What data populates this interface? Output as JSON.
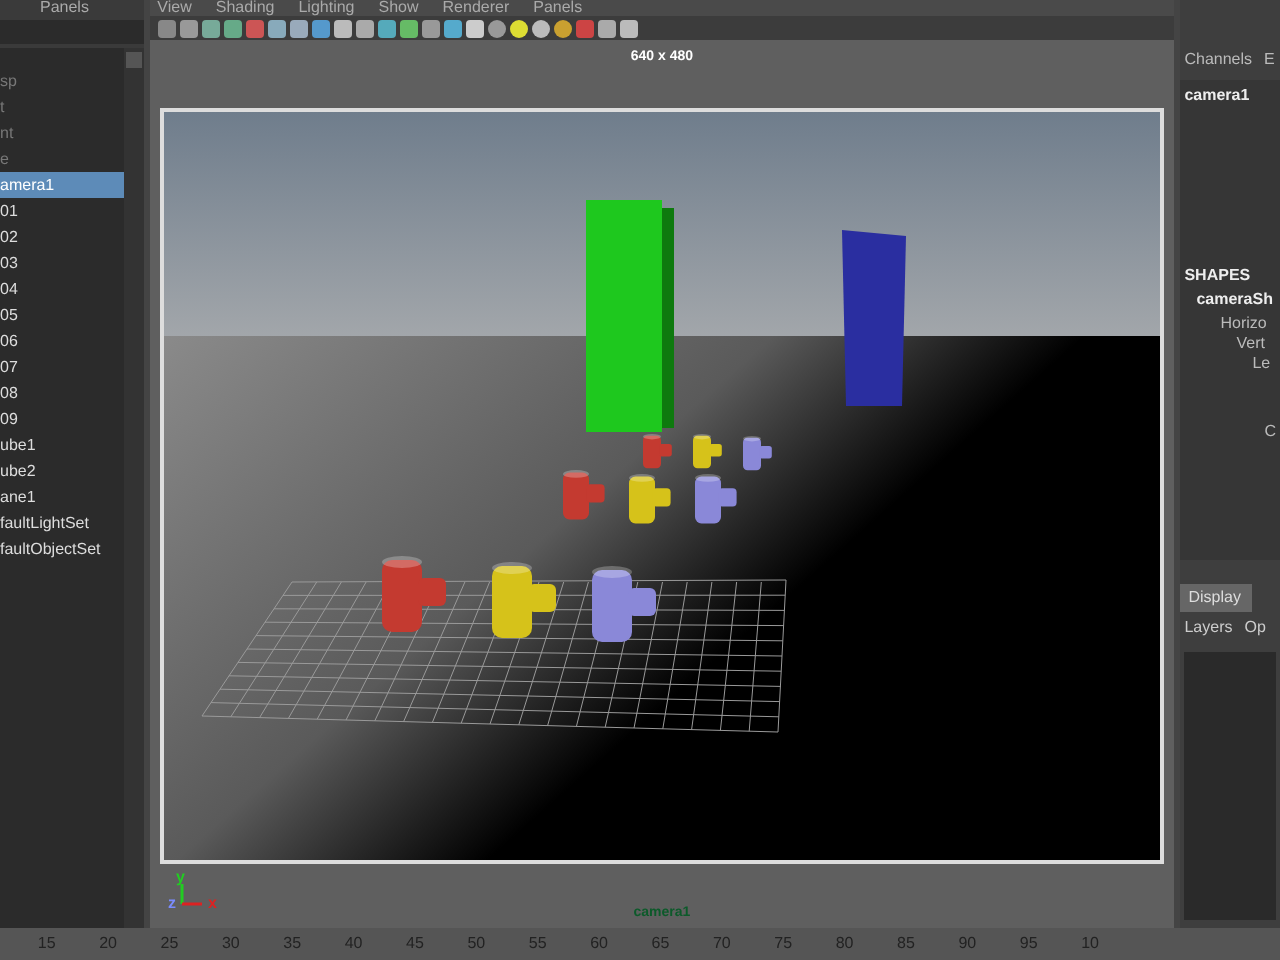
{
  "outliner": {
    "menu": "Panels",
    "items": [
      {
        "label": "sp",
        "selected": false
      },
      {
        "label": "t",
        "selected": false
      },
      {
        "label": "nt",
        "selected": false
      },
      {
        "label": "e",
        "selected": false
      },
      {
        "label": "amera1",
        "selected": true
      },
      {
        "label": "01",
        "selected": false
      },
      {
        "label": "02",
        "selected": false
      },
      {
        "label": "03",
        "selected": false
      },
      {
        "label": "04",
        "selected": false
      },
      {
        "label": "05",
        "selected": false
      },
      {
        "label": "06",
        "selected": false
      },
      {
        "label": "07",
        "selected": false
      },
      {
        "label": "08",
        "selected": false
      },
      {
        "label": "09",
        "selected": false
      },
      {
        "label": "ube1",
        "selected": false
      },
      {
        "label": "ube2",
        "selected": false
      },
      {
        "label": "ane1",
        "selected": false
      },
      {
        "label": "faultLightSet",
        "selected": false
      },
      {
        "label": "faultObjectSet",
        "selected": false
      }
    ]
  },
  "viewport": {
    "menus": [
      "View",
      "Shading",
      "Lighting",
      "Show",
      "Renderer",
      "Panels"
    ],
    "resolution": "640 x 480",
    "camera_label": "camera1",
    "axis_labels": [
      "y",
      "z",
      "x"
    ]
  },
  "channel_box": {
    "tabs": [
      "Channels",
      "E"
    ],
    "object": "camera1",
    "section": "SHAPES",
    "shape": "cameraSh",
    "attributes": [
      "Horizo",
      "Vert",
      "Le",
      "C"
    ]
  },
  "layer_editor": {
    "tabs": [
      {
        "label": "Display",
        "selected": true
      }
    ],
    "menus": [
      "Layers",
      "Op"
    ]
  },
  "timeline": {
    "ticks": [
      "15",
      "20",
      "25",
      "30",
      "35",
      "40",
      "45",
      "50",
      "55",
      "60",
      "65",
      "70",
      "75",
      "80",
      "85",
      "90",
      "95",
      "10"
    ]
  }
}
